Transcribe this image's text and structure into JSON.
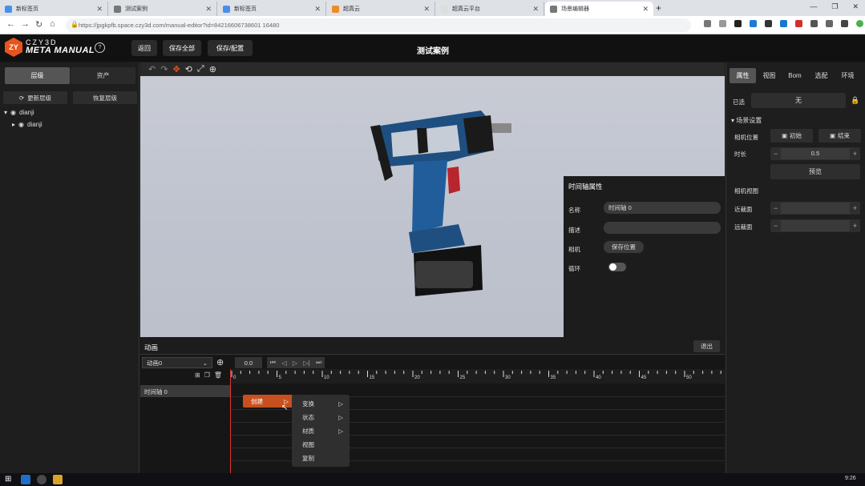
{
  "browser": {
    "tabs": [
      {
        "title": "新标签页",
        "color": "#4a8fe7"
      },
      {
        "title": "测试案例",
        "color": "#777777"
      },
      {
        "title": "新标签页",
        "color": "#4a8fe7"
      },
      {
        "title": "超真云",
        "color": "#f08a24"
      },
      {
        "title": "超真云平台",
        "color": "#dddddd"
      },
      {
        "title": "场景编辑器",
        "color": "#777777"
      }
    ],
    "active_tab": 5,
    "url": "https://jpgkpfb.space.czy3d.com/manual-editor?id=84216606738601 16480"
  },
  "app": {
    "logo_top": "CZY3D",
    "logo_main": "META MANUAL",
    "logo_mark": "ZY",
    "header_buttons": [
      "返回",
      "保存全部",
      "保存/配置"
    ],
    "title": "测试案例",
    "brand_color": "#e8541e"
  },
  "left": {
    "tabs": [
      "层级",
      "资产"
    ],
    "buttons": [
      "更新层级",
      "恢复层级"
    ],
    "tree": [
      "dianji",
      "dianji"
    ]
  },
  "timeline_props": {
    "title": "时间轴属性",
    "name_label": "名称",
    "name_value": "时间轴 0",
    "desc_label": "描述",
    "desc_value": "",
    "camera_label": "相机",
    "camera_button": "保存位置",
    "loop_label": "循环"
  },
  "right": {
    "tabs": [
      "属性",
      "视图",
      "Bom",
      "选配",
      "环境"
    ],
    "selected_label": "已选",
    "selected_value": "无",
    "section_title": "场景设置",
    "camera_pos_label": "相机位置",
    "start_button": "初始",
    "end_button": "结束",
    "duration_label": "时长",
    "duration_value": "0.5",
    "preview_button": "预览",
    "camera_view_label": "相机视图",
    "near_label": "近裁面",
    "far_label": "远裁面"
  },
  "animation": {
    "header": "动画",
    "exit_button": "退出",
    "select_value": "动画0",
    "time_value": "0.0",
    "track_label": "时间轴 0",
    "ruler_labels": [
      "0",
      "5",
      "10",
      "15",
      "20",
      "25",
      "30",
      "35",
      "40",
      "45",
      "50",
      "55"
    ]
  },
  "context": {
    "create_button": "创建",
    "menu": [
      {
        "label": "变换",
        "sub": true
      },
      {
        "label": "状态",
        "sub": true
      },
      {
        "label": "材质",
        "sub": true
      },
      {
        "label": "视图",
        "sub": false
      },
      {
        "label": "复制",
        "sub": false
      }
    ]
  },
  "taskbar": {
    "time": "9:26"
  }
}
